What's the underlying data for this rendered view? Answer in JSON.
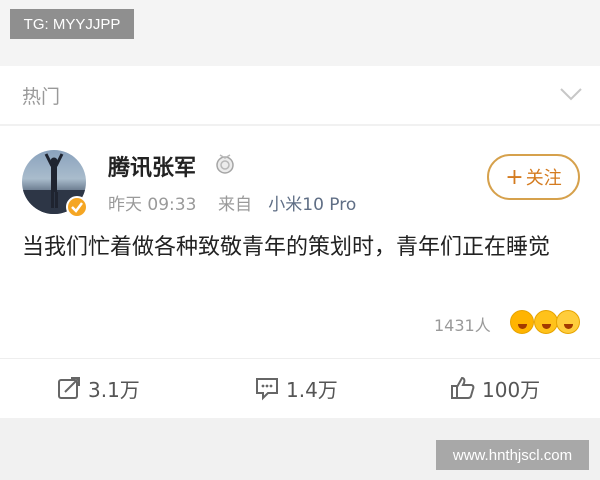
{
  "watermarks": {
    "top_left": "TG: MYYJJPP",
    "bottom_right": "www.hnthjscl.com"
  },
  "section": {
    "title": "热门",
    "chevron_icon": "chevron-down-icon"
  },
  "post": {
    "author": "腾讯张军",
    "time": "昨天 09:33",
    "source_prefix": "来自",
    "source": "小米10 Pro",
    "follow_label": "关注",
    "text": "当我们忙着做各种致敬青年的策划时，青年们正在睡觉",
    "reaction_count": "1431人",
    "actions": {
      "share": "3.1万",
      "comment": "1.4万",
      "like": "100万"
    }
  },
  "colors": {
    "accent": "#d47b1f",
    "verified": "#f5a623",
    "link": "#5f6e85"
  }
}
